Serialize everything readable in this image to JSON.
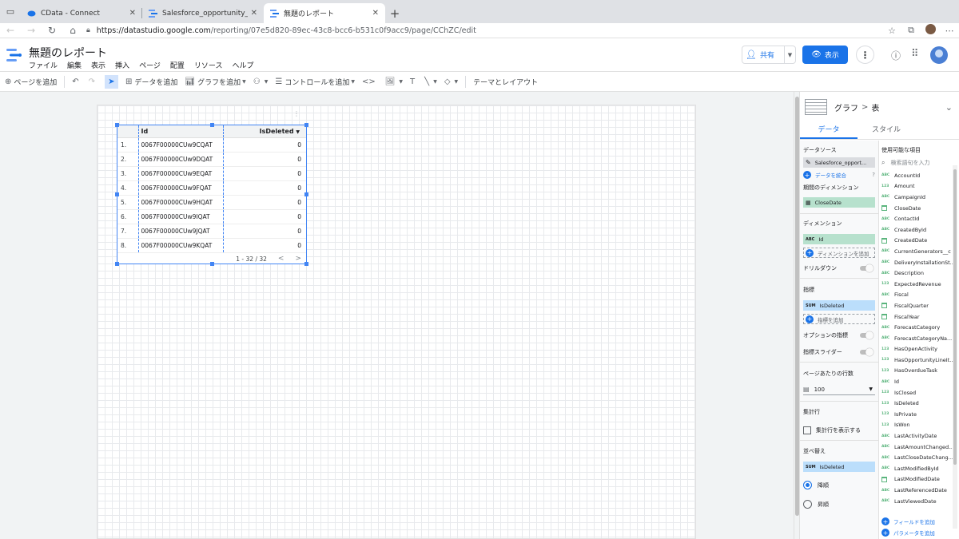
{
  "browser": {
    "tabs": [
      {
        "title": "CData - Connect",
        "active": false
      },
      {
        "title": "Salesforce_opportunity_Kuwa",
        "active": false
      },
      {
        "title": "無題のレポート",
        "active": true
      }
    ],
    "url_host": "https://datastudio.google.com",
    "url_path": "/reporting/07e5d820-89ec-43c8-bcc6-b531c0f9acc9/page/CChZC/edit"
  },
  "app": {
    "title": "無題のレポート",
    "menu": [
      "ファイル",
      "編集",
      "表示",
      "挿入",
      "ページ",
      "配置",
      "リソース",
      "ヘルプ"
    ],
    "share_label": "共有",
    "view_label": "表示"
  },
  "toolbar": {
    "add_page": "ページを追加",
    "add_data": "データを追加",
    "add_chart": "グラフを追加",
    "add_control": "コントロールを追加",
    "theme_layout": "テーマとレイアウト"
  },
  "table": {
    "col_id": "Id",
    "col_isdeleted": "IsDeleted",
    "rows": [
      {
        "n": "1.",
        "id": "0067F00000CUw9CQAT",
        "v": "0"
      },
      {
        "n": "2.",
        "id": "0067F00000CUw9DQAT",
        "v": "0"
      },
      {
        "n": "3.",
        "id": "0067F00000CUw9EQAT",
        "v": "0"
      },
      {
        "n": "4.",
        "id": "0067F00000CUw9FQAT",
        "v": "0"
      },
      {
        "n": "5.",
        "id": "0067F00000CUw9HQAT",
        "v": "0"
      },
      {
        "n": "6.",
        "id": "0067F00000CUw9IQAT",
        "v": "0"
      },
      {
        "n": "7.",
        "id": "0067F00000CUw9JQAT",
        "v": "0"
      },
      {
        "n": "8.",
        "id": "0067F00000CUw9KQAT",
        "v": "0"
      }
    ],
    "pager": "1 - 32 / 32"
  },
  "panel": {
    "breadcrumb_a": "グラフ",
    "breadcrumb_sep": ">",
    "breadcrumb_b": "表",
    "tab_data": "データ",
    "tab_style": "スタイル",
    "datasource_label": "データソース",
    "datasource_value": "Salesforce_opport...",
    "blend_label": "データを統合",
    "period_dim_label": "期間のディメンション",
    "period_dim_value": "CloseDate",
    "dimension_label": "ディメンション",
    "dimension_value": "Id",
    "dimension_add": "ディメンションを追加",
    "drilldown_label": "ドリルダウン",
    "metric_label": "指標",
    "metric_agg": "SUM",
    "metric_value": "IsDeleted",
    "metric_add": "指標を追加",
    "optional_metric_label": "オプションの指標",
    "metric_slider_label": "指標スライダー",
    "rows_per_page_label": "ページあたりの行数",
    "rows_per_page_value": "100",
    "summary_label": "集計行",
    "summary_checkbox": "集計行を表示する",
    "sort_label": "並べ替え",
    "sort_agg": "SUM",
    "sort_value": "IsDeleted",
    "sort_desc": "降順",
    "sort_asc": "昇順",
    "available_fields_label": "使用可能な項目",
    "search_placeholder": "検索語句を入力",
    "add_field": "フィールドを追加",
    "add_param": "パラメータを追加",
    "fields": [
      {
        "name": "AccountId",
        "type": "ABC"
      },
      {
        "name": "Amount",
        "type": "123"
      },
      {
        "name": "CampaignId",
        "type": "ABC"
      },
      {
        "name": "CloseDate",
        "type": "date"
      },
      {
        "name": "ContactId",
        "type": "ABC"
      },
      {
        "name": "CreatedById",
        "type": "ABC"
      },
      {
        "name": "CreatedDate",
        "type": "date"
      },
      {
        "name": "CurrentGenerators__c",
        "type": "ABC"
      },
      {
        "name": "DeliveryInstallationSt...",
        "type": "ABC"
      },
      {
        "name": "Description",
        "type": "ABC"
      },
      {
        "name": "ExpectedRevenue",
        "type": "123"
      },
      {
        "name": "Fiscal",
        "type": "ABC"
      },
      {
        "name": "FiscalQuarter",
        "type": "date"
      },
      {
        "name": "FiscalYear",
        "type": "date"
      },
      {
        "name": "ForecastCategory",
        "type": "ABC"
      },
      {
        "name": "ForecastCategoryNa...",
        "type": "ABC"
      },
      {
        "name": "HasOpenActivity",
        "type": "123"
      },
      {
        "name": "HasOpportunityLineIt...",
        "type": "123"
      },
      {
        "name": "HasOverdueTask",
        "type": "123"
      },
      {
        "name": "Id",
        "type": "ABC"
      },
      {
        "name": "IsClosed",
        "type": "123"
      },
      {
        "name": "IsDeleted",
        "type": "123"
      },
      {
        "name": "IsPrivate",
        "type": "123"
      },
      {
        "name": "IsWon",
        "type": "123"
      },
      {
        "name": "LastActivityDate",
        "type": "ABC"
      },
      {
        "name": "LastAmountChanged...",
        "type": "ABC"
      },
      {
        "name": "LastCloseDateChang...",
        "type": "ABC"
      },
      {
        "name": "LastModifiedById",
        "type": "ABC"
      },
      {
        "name": "LastModifiedDate",
        "type": "date"
      },
      {
        "name": "LastReferencedDate",
        "type": "ABC"
      },
      {
        "name": "LastViewedDate",
        "type": "ABC"
      }
    ]
  }
}
